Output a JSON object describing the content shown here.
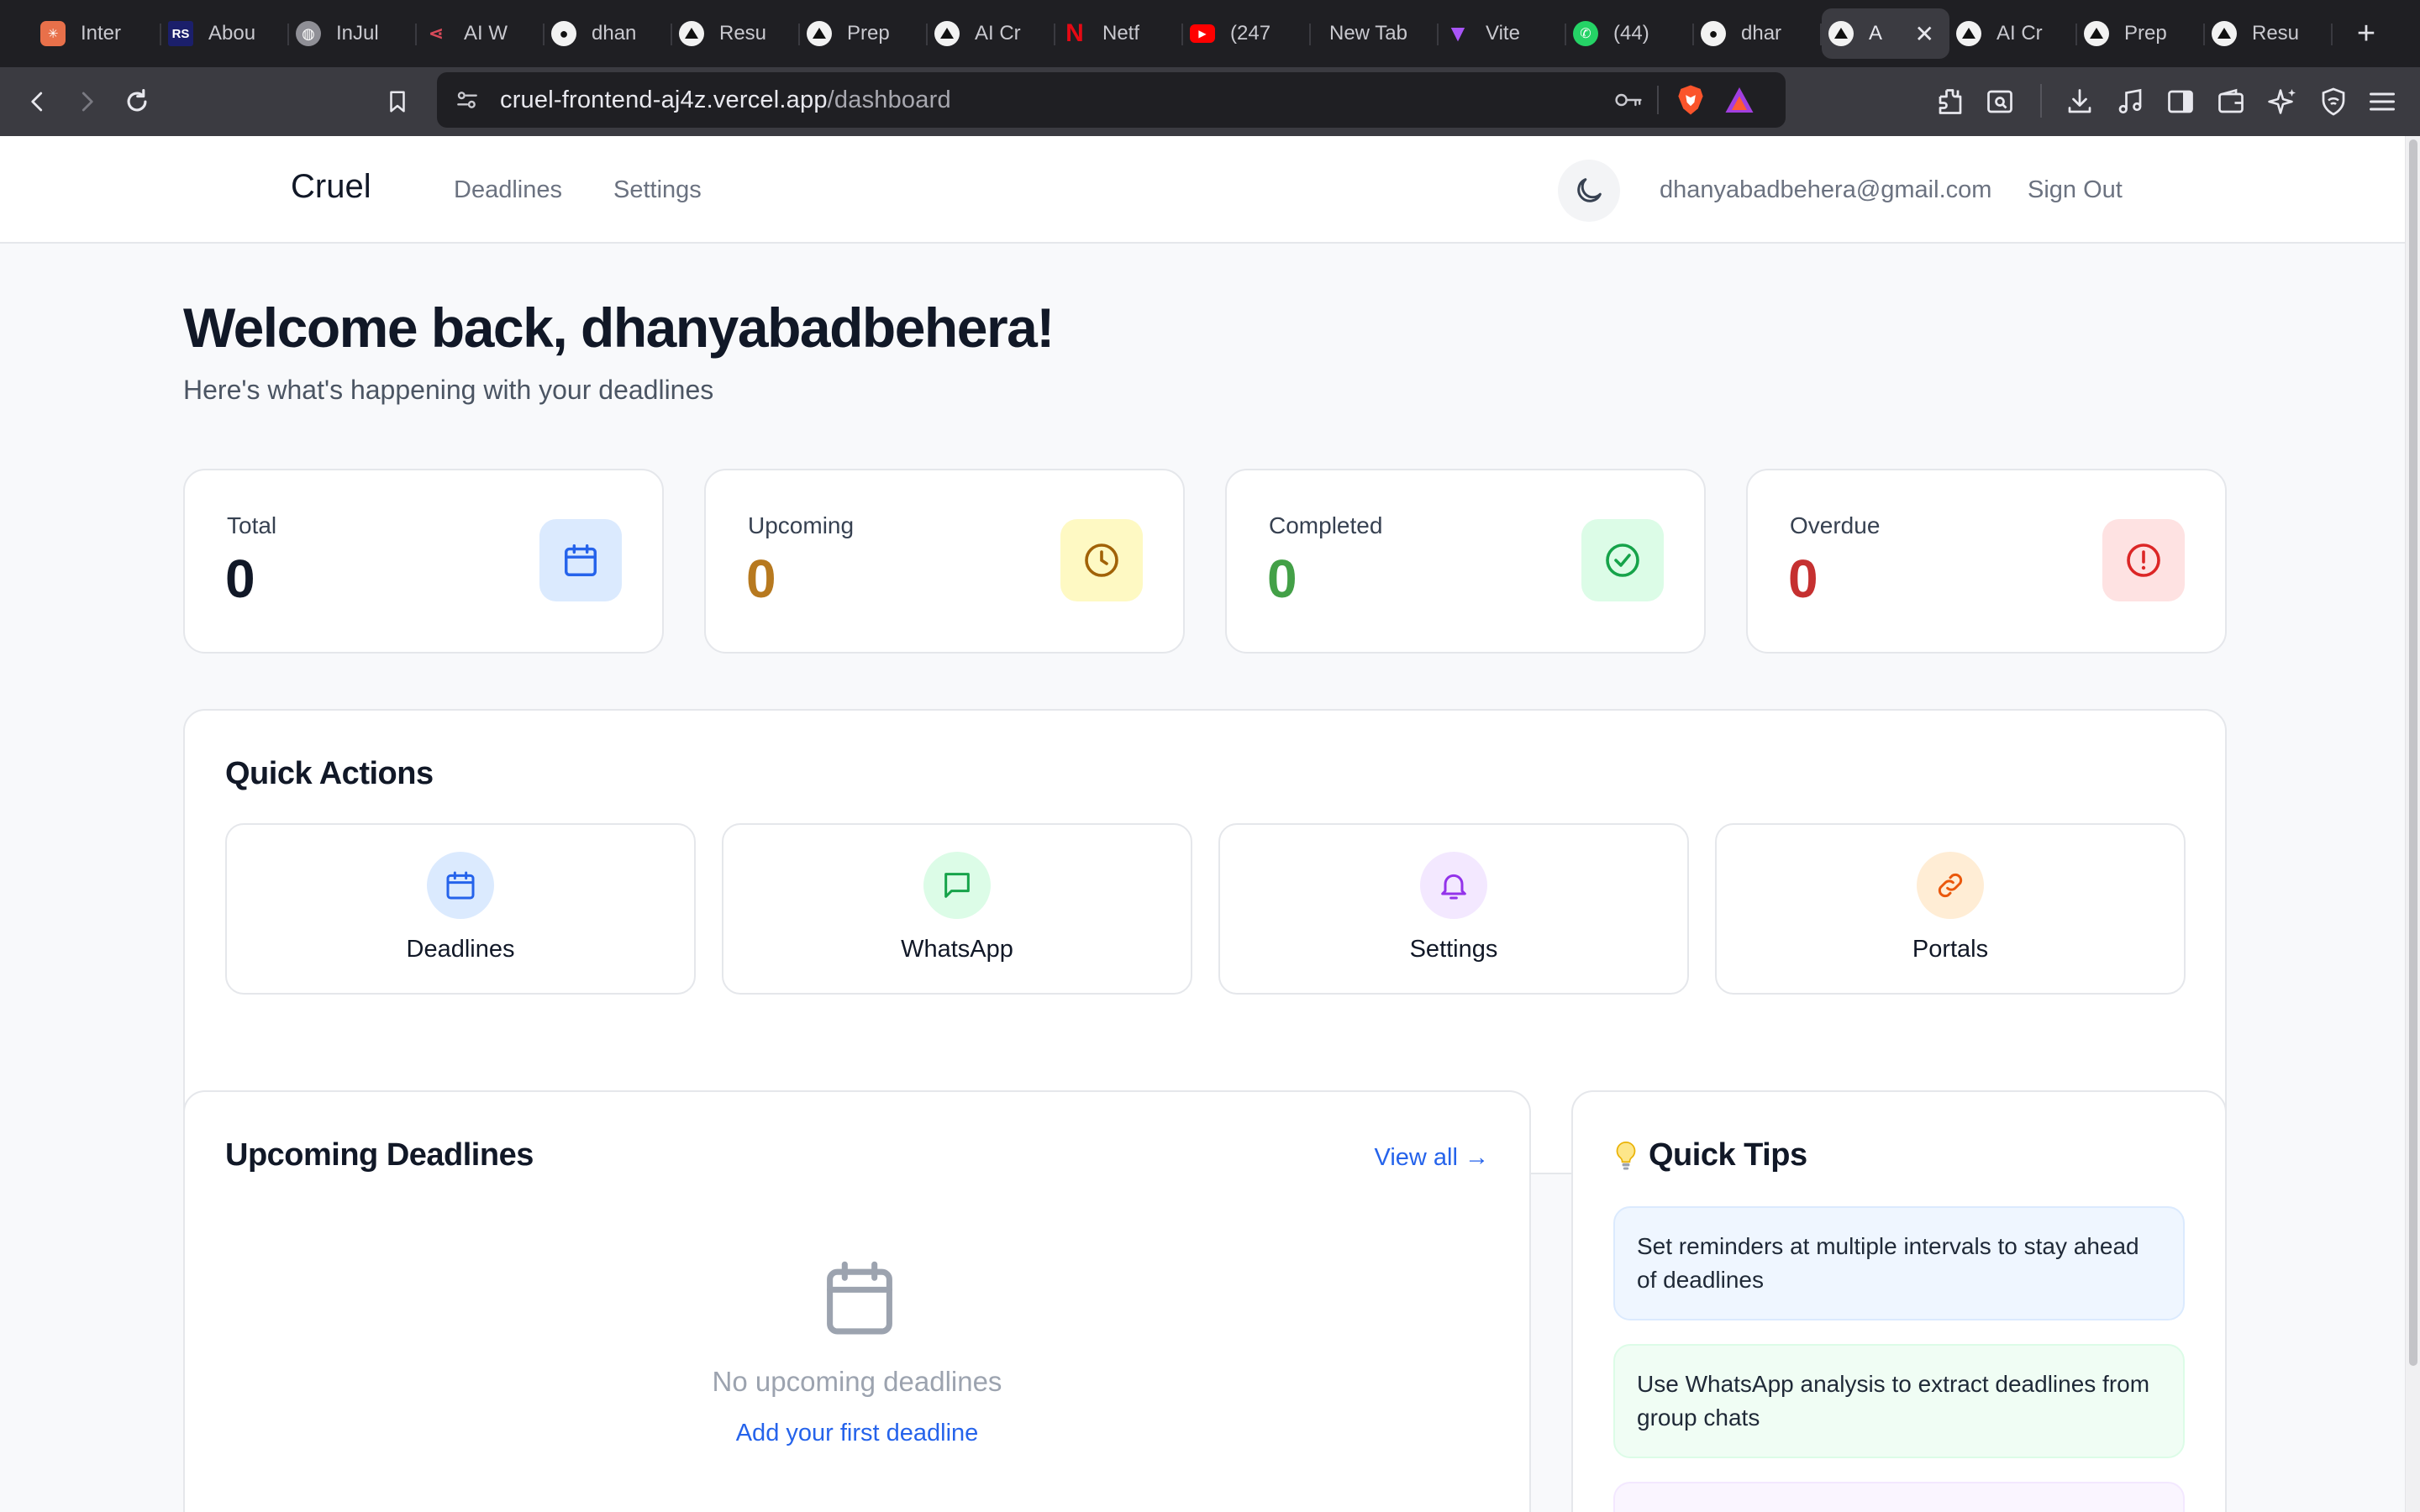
{
  "browser": {
    "tabs": [
      {
        "label": "Inter",
        "icon": "claude-icon",
        "color": "#e8704a"
      },
      {
        "label": "Abou",
        "icon": "rs-icon",
        "color": "#1b1f6b"
      },
      {
        "label": "InJul",
        "icon": "globe-icon",
        "color": "#9a9aa0"
      },
      {
        "label": "AI W",
        "icon": "share-icon",
        "color": "#d94a5a"
      },
      {
        "label": "dhan",
        "icon": "github-icon",
        "color": "#ffffff"
      },
      {
        "label": "Resu",
        "icon": "vercel-icon",
        "color": "#ffffff"
      },
      {
        "label": "Prep",
        "icon": "vercel-icon",
        "color": "#ffffff"
      },
      {
        "label": "AI Cr",
        "icon": "vercel-icon",
        "color": "#ffffff"
      },
      {
        "label": "Netf",
        "icon": "netflix-icon",
        "color": "#e50914"
      },
      {
        "label": "(247",
        "icon": "youtube-icon",
        "color": "#ff0000"
      },
      {
        "label": "New Tab",
        "icon": "",
        "color": ""
      },
      {
        "label": "Vite",
        "icon": "vite-icon",
        "color": "#a855f7"
      },
      {
        "label": "(44)",
        "icon": "whatsapp-icon",
        "color": "#25d366"
      },
      {
        "label": "dhar",
        "icon": "github-icon",
        "color": "#ffffff"
      },
      {
        "label": "A",
        "icon": "vercel-icon",
        "color": "#ffffff",
        "active": true
      },
      {
        "label": "AI Cr",
        "icon": "vercel-icon",
        "color": "#ffffff"
      },
      {
        "label": "Prep",
        "icon": "vercel-icon",
        "color": "#ffffff"
      },
      {
        "label": "Resu",
        "icon": "vercel-icon",
        "color": "#ffffff"
      }
    ],
    "url_host": "cruel-frontend-aj4z.vercel.app",
    "url_path": "/dashboard"
  },
  "app": {
    "brand": "Cruel",
    "nav": {
      "deadlines": "Deadlines",
      "settings": "Settings"
    },
    "user_email": "dhanyabadbehera@gmail.com",
    "sign_out": "Sign Out"
  },
  "header": {
    "welcome": "Welcome back, dhanyabadbehera!",
    "subtitle": "Here's what's happening with your deadlines"
  },
  "stats": [
    {
      "label": "Total",
      "value": "0",
      "color": "#111827",
      "icon": "calendar-icon",
      "icon_bg": "#dbeafe",
      "icon_color": "#2563eb"
    },
    {
      "label": "Upcoming",
      "value": "0",
      "color": "#b7791f",
      "icon": "clock-icon",
      "icon_bg": "#fef9c3",
      "icon_color": "#a16207"
    },
    {
      "label": "Completed",
      "value": "0",
      "color": "#43a047",
      "icon": "check-circle-icon",
      "icon_bg": "#dcfce7",
      "icon_color": "#16a34a"
    },
    {
      "label": "Overdue",
      "value": "0",
      "color": "#c53030",
      "icon": "alert-circle-icon",
      "icon_bg": "#fee2e2",
      "icon_color": "#dc2626"
    }
  ],
  "quick_actions": {
    "title": "Quick Actions",
    "items": [
      {
        "label": "Deadlines",
        "icon": "calendar-icon",
        "icon_bg": "#dbeafe",
        "icon_color": "#2563eb"
      },
      {
        "label": "WhatsApp",
        "icon": "message-icon",
        "icon_bg": "#dcfce7",
        "icon_color": "#16a34a"
      },
      {
        "label": "Settings",
        "icon": "bell-icon",
        "icon_bg": "#f3e8ff",
        "icon_color": "#9333ea"
      },
      {
        "label": "Portals",
        "icon": "link-icon",
        "icon_bg": "#ffedd5",
        "icon_color": "#ea580c"
      }
    ]
  },
  "upcoming": {
    "title": "Upcoming Deadlines",
    "view_all": "View all →",
    "empty_text": "No upcoming deadlines",
    "empty_link": "Add your first deadline"
  },
  "tips": {
    "title": "Quick Tips",
    "title_icon": "lightbulb-icon",
    "items": [
      {
        "text": "Set reminders at multiple intervals to stay ahead of deadlines",
        "bg": "#eff6ff",
        "border": "#dbeafe"
      },
      {
        "text": "Use WhatsApp analysis to extract deadlines from group chats",
        "bg": "#f0fdf4",
        "border": "#dcfce7"
      },
      {
        "text": "",
        "bg": "#faf5ff",
        "border": "#f3e8ff"
      }
    ]
  }
}
